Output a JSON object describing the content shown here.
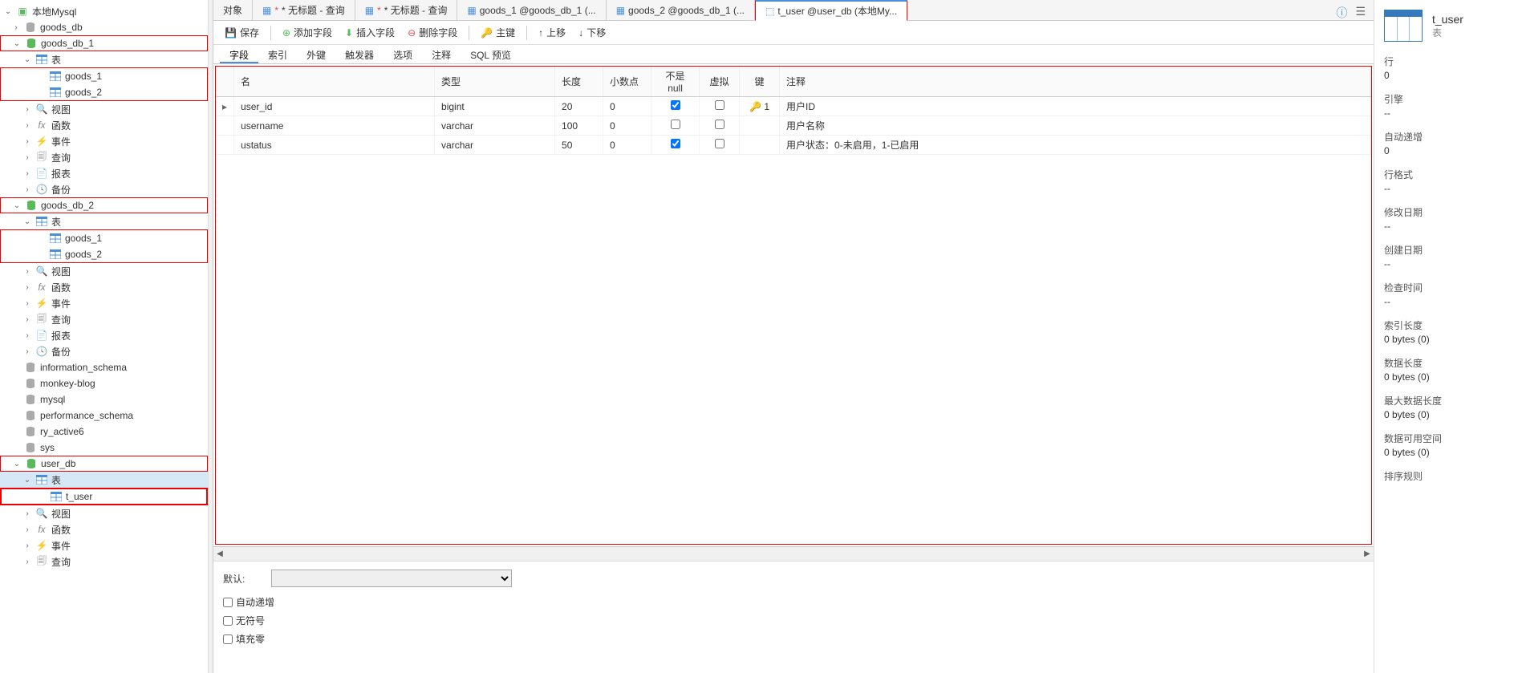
{
  "app": {
    "connection_name": "本地Mysql"
  },
  "sidebar": {
    "databases": [
      {
        "name": "goods_db",
        "style": "gray",
        "children": []
      },
      {
        "name": "goods_db_1",
        "style": "green",
        "highlight": true,
        "expanded": true,
        "children": [
          {
            "type": "tables_folder",
            "label": "表",
            "expanded": true,
            "highlight_children": true,
            "items": [
              {
                "name": "goods_1"
              },
              {
                "name": "goods_2"
              }
            ]
          },
          {
            "type": "folder",
            "label": "视图",
            "icon": "view"
          },
          {
            "type": "folder",
            "label": "函数",
            "icon": "fn"
          },
          {
            "type": "folder",
            "label": "事件",
            "icon": "event"
          },
          {
            "type": "folder",
            "label": "查询",
            "icon": "query"
          },
          {
            "type": "folder",
            "label": "报表",
            "icon": "report"
          },
          {
            "type": "folder",
            "label": "备份",
            "icon": "backup"
          }
        ]
      },
      {
        "name": "goods_db_2",
        "style": "green",
        "highlight": true,
        "expanded": true,
        "children": [
          {
            "type": "tables_folder",
            "label": "表",
            "expanded": true,
            "highlight_children": true,
            "items": [
              {
                "name": "goods_1"
              },
              {
                "name": "goods_2"
              }
            ]
          },
          {
            "type": "folder",
            "label": "视图",
            "icon": "view"
          },
          {
            "type": "folder",
            "label": "函数",
            "icon": "fn"
          },
          {
            "type": "folder",
            "label": "事件",
            "icon": "event"
          },
          {
            "type": "folder",
            "label": "查询",
            "icon": "query"
          },
          {
            "type": "folder",
            "label": "报表",
            "icon": "report"
          },
          {
            "type": "folder",
            "label": "备份",
            "icon": "backup"
          }
        ]
      },
      {
        "name": "information_schema",
        "style": "gray"
      },
      {
        "name": "monkey-blog",
        "style": "gray"
      },
      {
        "name": "mysql",
        "style": "gray"
      },
      {
        "name": "performance_schema",
        "style": "gray"
      },
      {
        "name": "ry_active6",
        "style": "gray"
      },
      {
        "name": "sys",
        "style": "gray"
      },
      {
        "name": "user_db",
        "style": "green",
        "highlight": true,
        "expanded": true,
        "children": [
          {
            "type": "tables_folder",
            "label": "表",
            "expanded": true,
            "highlight_children": true,
            "selected": true,
            "items": [
              {
                "name": "t_user",
                "highlight": true
              }
            ]
          },
          {
            "type": "folder",
            "label": "视图",
            "icon": "view"
          },
          {
            "type": "folder",
            "label": "函数",
            "icon": "fn"
          },
          {
            "type": "folder",
            "label": "事件",
            "icon": "event"
          },
          {
            "type": "folder",
            "label": "查询",
            "icon": "query"
          }
        ]
      }
    ]
  },
  "tabs": {
    "items": [
      {
        "label": "对象",
        "icon": "none"
      },
      {
        "label": "* 无标题 - 查询",
        "icon": "query-star"
      },
      {
        "label": "* 无标题 - 查询",
        "icon": "query-star"
      },
      {
        "label": "goods_1 @goods_db_1 (...",
        "icon": "table"
      },
      {
        "label": "goods_2 @goods_db_1 (...",
        "icon": "table"
      },
      {
        "label": "t_user @user_db (本地My...",
        "icon": "design",
        "active": true
      }
    ]
  },
  "toolbar": {
    "save": "保存",
    "add_field": "添加字段",
    "insert_field": "插入字段",
    "delete_field": "删除字段",
    "primary_key": "主键",
    "move_up": "上移",
    "move_down": "下移"
  },
  "subtabs": {
    "items": [
      "字段",
      "索引",
      "外键",
      "触发器",
      "选项",
      "注释",
      "SQL 预览"
    ],
    "active": 0
  },
  "grid": {
    "headers": {
      "name": "名",
      "type": "类型",
      "length": "长度",
      "decimals": "小数点",
      "notnull": "不是 null",
      "virtual": "虚拟",
      "key": "键",
      "comment": "注释"
    },
    "rows": [
      {
        "marker": true,
        "name": "user_id",
        "type": "bigint",
        "length": "20",
        "decimals": "0",
        "notnull": true,
        "virtual": false,
        "key": "1",
        "comment": "用户ID"
      },
      {
        "marker": false,
        "name": "username",
        "type": "varchar",
        "length": "100",
        "decimals": "0",
        "notnull": false,
        "virtual": false,
        "key": "",
        "comment": "用户名称"
      },
      {
        "marker": false,
        "name": "ustatus",
        "type": "varchar",
        "length": "50",
        "decimals": "0",
        "notnull": true,
        "virtual": false,
        "key": "",
        "comment": "用户状态：0-未启用，1-已启用"
      }
    ]
  },
  "bottom": {
    "default_label": "默认:",
    "auto_increment": "自动递增",
    "unsigned": "无符号",
    "zerofill": "填充零"
  },
  "right": {
    "title": "t_user",
    "subtitle": "表",
    "props": [
      {
        "label": "行",
        "value": "0"
      },
      {
        "label": "引擎",
        "value": "--"
      },
      {
        "label": "自动递增",
        "value": "0"
      },
      {
        "label": "行格式",
        "value": "--"
      },
      {
        "label": "修改日期",
        "value": "--"
      },
      {
        "label": "创建日期",
        "value": "--"
      },
      {
        "label": "检查时间",
        "value": "--"
      },
      {
        "label": "索引长度",
        "value": "0 bytes (0)"
      },
      {
        "label": "数据长度",
        "value": "0 bytes (0)"
      },
      {
        "label": "最大数据长度",
        "value": "0 bytes (0)"
      },
      {
        "label": "数据可用空间",
        "value": "0 bytes (0)"
      },
      {
        "label": "排序规则",
        "value": ""
      }
    ]
  },
  "top_icons": {
    "info": "ⓘ",
    "list": "☰"
  }
}
